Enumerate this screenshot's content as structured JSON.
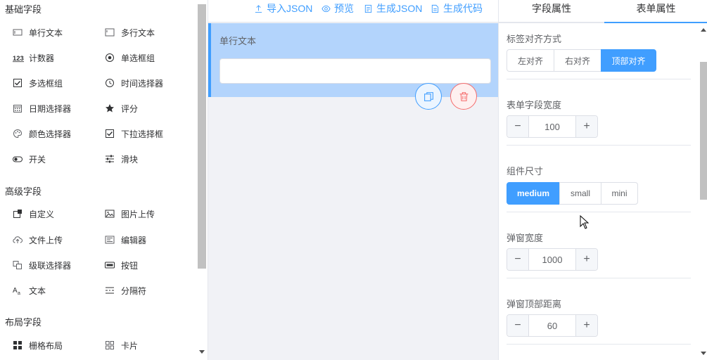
{
  "left_panel": {
    "sections": [
      {
        "title": "基础字段",
        "items": [
          {
            "label": "单行文本",
            "icon": "input-icon"
          },
          {
            "label": "多行文本",
            "icon": "textarea-icon"
          },
          {
            "label": "计数器",
            "icon": "number-123-icon"
          },
          {
            "label": "单选框组",
            "icon": "radio-icon"
          },
          {
            "label": "多选框组",
            "icon": "checkbox-icon"
          },
          {
            "label": "时间选择器",
            "icon": "clock-icon"
          },
          {
            "label": "日期选择器",
            "icon": "calendar-icon"
          },
          {
            "label": "评分",
            "icon": "star-icon"
          },
          {
            "label": "颜色选择器",
            "icon": "palette-icon"
          },
          {
            "label": "下拉选择框",
            "icon": "select-check-icon"
          },
          {
            "label": "开关",
            "icon": "switch-icon"
          },
          {
            "label": "滑块",
            "icon": "slider-icon"
          }
        ]
      },
      {
        "title": "高级字段",
        "items": [
          {
            "label": "自定义",
            "icon": "custom-icon"
          },
          {
            "label": "图片上传",
            "icon": "image-icon"
          },
          {
            "label": "文件上传",
            "icon": "cloud-upload-icon"
          },
          {
            "label": "编辑器",
            "icon": "editor-icon"
          },
          {
            "label": "级联选择器",
            "icon": "cascader-icon"
          },
          {
            "label": "按钮",
            "icon": "button-icon"
          },
          {
            "label": "文本",
            "icon": "text-icon"
          },
          {
            "label": "分隔符",
            "icon": "divider-icon"
          }
        ]
      },
      {
        "title": "布局字段",
        "items": [
          {
            "label": "栅格布局",
            "icon": "grid-icon"
          },
          {
            "label": "卡片",
            "icon": "card-icon"
          }
        ]
      }
    ]
  },
  "toolbar": {
    "import_json": "导入JSON",
    "preview": "预览",
    "gen_json": "生成JSON",
    "gen_code": "生成代码"
  },
  "canvas": {
    "field_label": "单行文本"
  },
  "right_panel": {
    "tabs": [
      "字段属性",
      "表单属性"
    ],
    "active_tab": "表单属性",
    "label_align": {
      "label": "标签对齐方式",
      "options": [
        "左对齐",
        "右对齐",
        "顶部对齐"
      ],
      "selected": "顶部对齐"
    },
    "field_width": {
      "label": "表单字段宽度",
      "value": "100"
    },
    "component_size": {
      "label": "组件尺寸",
      "options": [
        "medium",
        "small",
        "mini"
      ],
      "selected": "medium"
    },
    "dialog_width": {
      "label": "弹窗宽度",
      "value": "1000"
    },
    "dialog_top": {
      "label": "弹窗顶部距离",
      "value": "60"
    }
  },
  "colors": {
    "primary": "#409eff",
    "danger": "#f56c6c",
    "selected_bg": "#b3d4fc",
    "canvas_bg": "#f1f2f6"
  }
}
